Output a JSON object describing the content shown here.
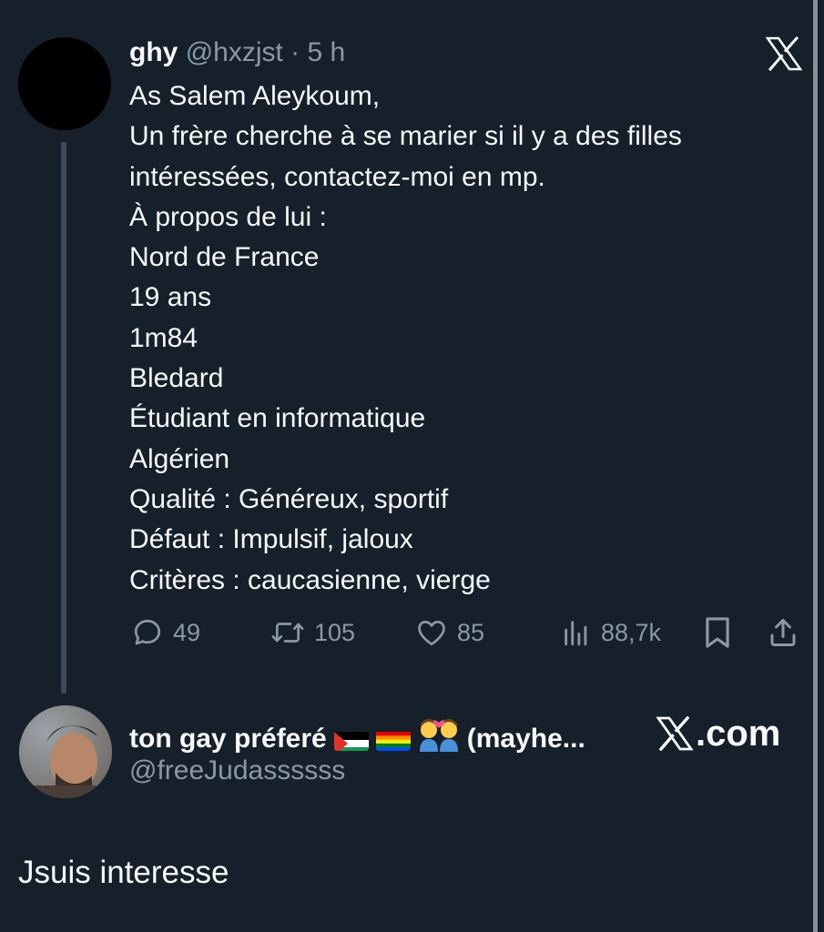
{
  "quoted_tweet": {
    "display_name": "ghy",
    "handle": "@hxzjst",
    "separator": "·",
    "time": "5 h",
    "lines": [
      "As Salem Aleykoum,",
      "Un frère cherche à se marier si il y a des filles",
      "intéressées, contactez-moi en mp.",
      "À propos de lui :",
      "Nord de France",
      "19 ans",
      "1m84",
      "Bledard",
      "Étudiant en informatique",
      "Algérien",
      "Qualité : Généreux, sportif",
      "Défaut : Impulsif, jaloux",
      "Critères : caucasienne, vierge"
    ],
    "actions": {
      "replies": "49",
      "reposts": "105",
      "likes": "85",
      "views": "88,7k"
    }
  },
  "reply": {
    "display_name": "ton gay préferé",
    "display_name_suffix": "(mayhe...",
    "handle": "@freeJudassssss",
    "text": "Jsuis interesse",
    "badges": [
      "palestine-flag-emoji",
      "rainbow-flag-emoji",
      "couple-with-heart-emoji"
    ]
  },
  "watermark": {
    "text": ".com"
  },
  "colors": {
    "background": "#15202b",
    "text": "#f7f9f9",
    "secondary": "#8b98a5"
  }
}
